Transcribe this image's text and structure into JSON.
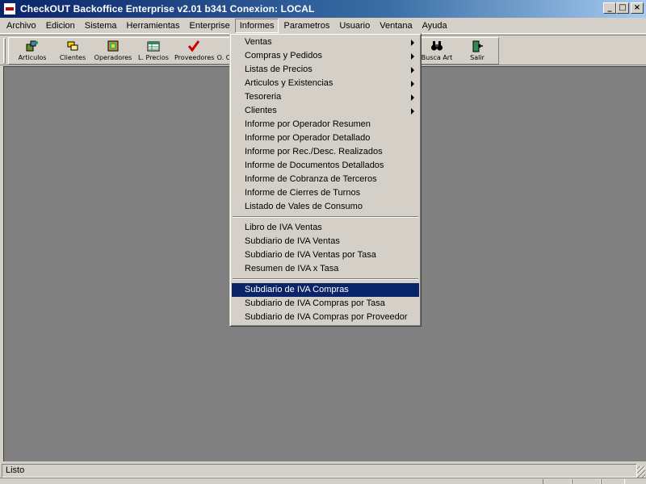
{
  "window": {
    "title": "CheckOUT Backoffice Enterprise v2.01 b341 Conexion: LOCAL",
    "minimize": "_",
    "maximize": "□",
    "close": "×"
  },
  "menubar": {
    "items": [
      "Archivo",
      "Edicion",
      "Sistema",
      "Herramientas",
      "Enterprise",
      "Informes",
      "Parametros",
      "Usuario",
      "Ventana",
      "Ayuda"
    ],
    "open_item": "Informes"
  },
  "toolbar": {
    "buttons": [
      {
        "label": "Articulos",
        "icon": "articles-icon"
      },
      {
        "label": "Clientes",
        "icon": "clients-icon"
      },
      {
        "label": "Operadores",
        "icon": "operators-icon"
      },
      {
        "label": "L. Precios",
        "icon": "price-list-icon"
      },
      {
        "label": "Proveedores",
        "icon": "checkmark-icon"
      },
      {
        "label": "O. C",
        "icon": "purchase-order-icon"
      },
      {
        "label": "Busca Art",
        "icon": "binoculars-icon"
      },
      {
        "label": "Salir",
        "icon": "exit-door-icon"
      }
    ]
  },
  "informes_menu": {
    "submenus": [
      "Ventas",
      "Compras y Pedidos",
      "Listas de Precios",
      "Articulos y Existencias",
      "Tesoreria",
      "Clientes"
    ],
    "reports": [
      "Informe por Operador Resumen",
      "Informe por Operador Detallado",
      "Informe por Rec./Desc. Realizados",
      "Informe de Documentos Detallados",
      "Informe de Cobranza de Terceros",
      "Informe de Cierres de Turnos",
      "Listado de Vales de Consumo"
    ],
    "iva_ventas": [
      "Libro de IVA Ventas",
      "Subdiario de IVA Ventas",
      "Subdiario de IVA Ventas por Tasa",
      "Resumen de IVA x Tasa"
    ],
    "iva_compras": [
      "Subdiario de IVA Compras",
      "Subdiario de IVA Compras por Tasa",
      "Subdiario de IVA Compras por Proveedor"
    ],
    "highlighted": "Subdiario de IVA Compras"
  },
  "statusbar": {
    "text": "Listo"
  },
  "colors": {
    "titlebar_start": "#0a246a",
    "titlebar_end": "#a6caf0",
    "highlight": "#0a246a",
    "client_bg": "#808080",
    "face": "#d4d0c8"
  }
}
